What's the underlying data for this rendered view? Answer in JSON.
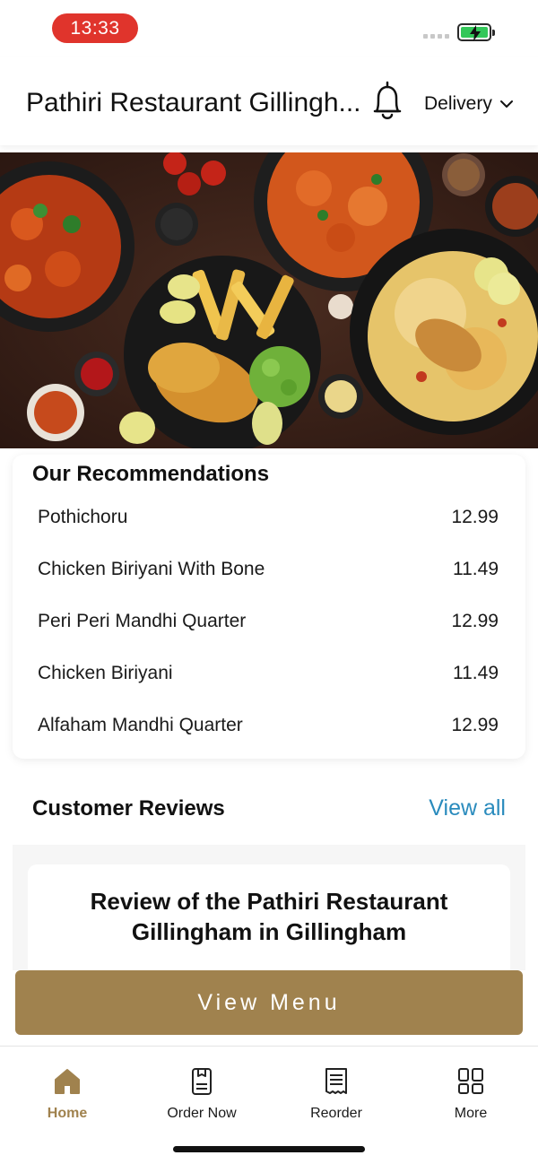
{
  "status_bar": {
    "time": "13:33",
    "battery_color": "#33c759"
  },
  "header": {
    "title": "Pathiri Restaurant Gillingh...",
    "mode": "Delivery",
    "bell_icon": "bell-icon",
    "chevron_icon": "chevron-down-icon"
  },
  "recommendations": {
    "title": "Our Recommendations",
    "items": [
      {
        "name": "Pothichoru",
        "price": "12.99"
      },
      {
        "name": "Chicken Biriyani With Bone",
        "price": "11.49"
      },
      {
        "name": "Peri Peri Mandhi Quarter",
        "price": "12.99"
      },
      {
        "name": "Chicken Biriyani",
        "price": "11.49"
      },
      {
        "name": "Alfaham Mandhi Quarter",
        "price": "12.99"
      }
    ]
  },
  "reviews": {
    "title": "Customer Reviews",
    "view_all": "View all",
    "card_title": "Review of the Pathiri Restaurant Gillingham in Gillingham"
  },
  "cta": {
    "label": "View Menu",
    "color": "#a0824e"
  },
  "tabs": [
    {
      "label": "Home",
      "icon": "home-icon",
      "active": true
    },
    {
      "label": "Order Now",
      "icon": "order-icon",
      "active": false
    },
    {
      "label": "Reorder",
      "icon": "receipt-icon",
      "active": false
    },
    {
      "label": "More",
      "icon": "grid-icon",
      "active": false
    }
  ],
  "colors": {
    "accent": "#a0824e",
    "link": "#2a8bbd",
    "time_pill": "#e0342c"
  }
}
